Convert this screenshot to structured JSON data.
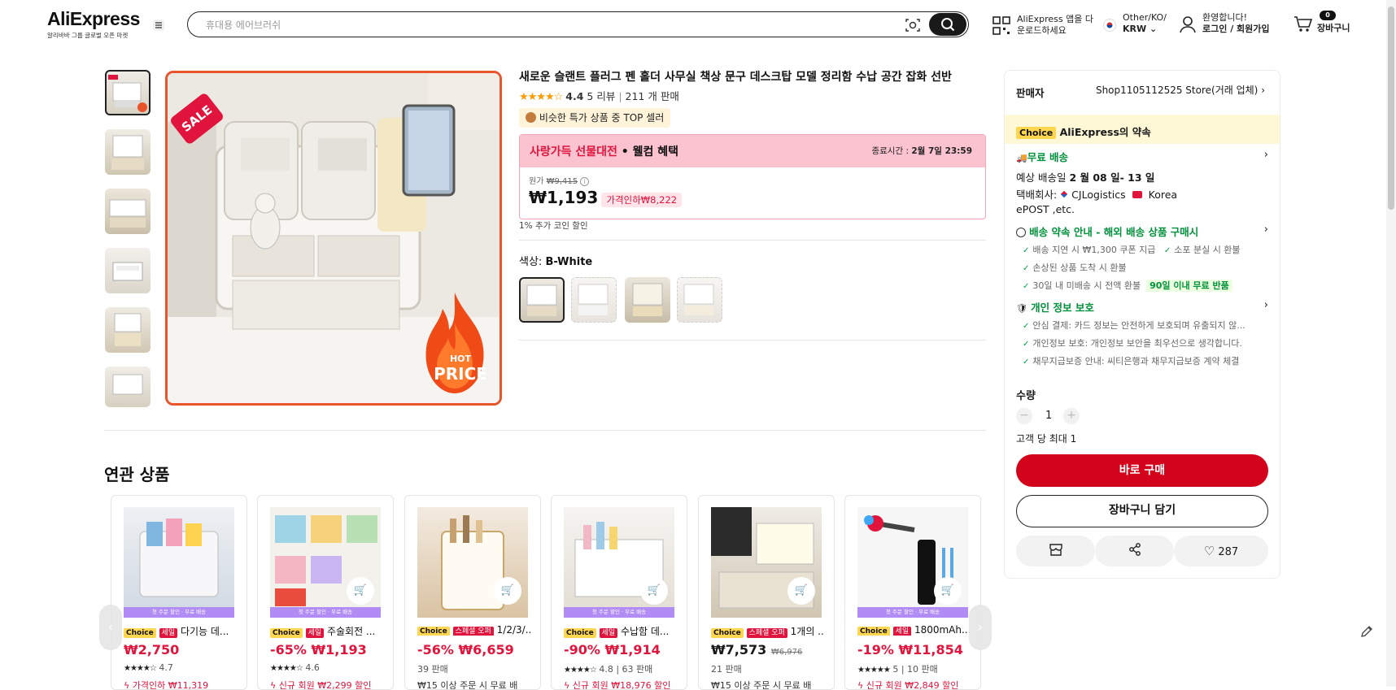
{
  "header": {
    "logo": "AliExpress",
    "logo_sub": "알리바바 그룹 글로벌 오픈 마켓",
    "search_placeholder": "휴대용 에어브러쉬",
    "app_line1": "AliExpress 앱을 다",
    "app_line2": "운로드하세요",
    "locale_line1": "Other/KO/",
    "locale_line2": "KRW",
    "user_line1": "환영합니다!",
    "user_line2": "로그인 / 회원가입",
    "cart_count": "0",
    "cart_label": "장바구니"
  },
  "product": {
    "title": "새로운 슬랜트 플러그 펜 홀더 사무실 책상 문구 데스크탑 모델 정리함 수납 공간 잡화 선반",
    "rating": "4.4",
    "reviews": "5 리뷰",
    "sold": "211 개 판매",
    "top_badge": "비슷한 특가 상품 중 TOP 셀러",
    "promo_title": "사랑가득 선물대전",
    "promo_sub": " • 웰컴 혜택",
    "promo_time_label": "종료시간 : ",
    "promo_time": "2월 7일 23:59",
    "orig_label": "원가 ",
    "orig_price": "₩9,415",
    "price": "₩1,193",
    "discount": "가격인하₩8,222",
    "coin_note": "1% 추가 코인 할인",
    "color_label": "색상: ",
    "color_value": "B-White",
    "image_labels": {
      "sale": "SALE",
      "hot": "HOT",
      "price": "PRICE"
    }
  },
  "panel": {
    "seller_label": "판매자",
    "seller_name": "Shop1105112525 Store(거래 업체)",
    "choice": "Choice",
    "promise": "AliExpress의 약속",
    "free_ship": "무료 배송",
    "eta_prefix": "예상 배송일 ",
    "eta": "2 월 08 일- 13 일",
    "carrier_prefix": "택배회사: ",
    "carrier": "CJLogistics",
    "carrier2": "Korea",
    "carrier3": "ePOST ,etc.",
    "delivery_promise": "배송 약속 안내 - 해외 배송 상품 구매시",
    "dp1": "배송 지연 시 ₩1,300 쿠폰 지급",
    "dp2": "소포 분실 시 환불",
    "dp3": "손상된 상품 도착 시 환불",
    "dp4": "30일 내 미배송 시 전액 환불",
    "dp_return": "90일 이내 무료 반품",
    "privacy": "개인 정보 보호",
    "pv1": "안심 결제: 카드 정보는 안전하게 보호되며 유출되지 않...",
    "pv2": "개인정보 보호: 개인정보 보안을 최우선으로 생각합니다.",
    "pv3": "채무지급보증 안내: 씨티은행과 채무지급보증 계약 체결",
    "qty_label": "수량",
    "qty": "1",
    "limit": "고객 당 최대 1",
    "buy_now": "바로 구매",
    "add_cart": "장바구니 담기",
    "wish_count": "287"
  },
  "related": {
    "title": "연관 상품",
    "band": "첫 주문 할인 · 무료 배송",
    "items": [
      {
        "choice": "Choice",
        "tag": "세일",
        "name": "다기능 데...",
        "price": "₩2,750",
        "meta": "4.7",
        "extra": "가격인하 ₩11,319"
      },
      {
        "choice": "Choice",
        "tag": "세일",
        "name": "주술회전 ...",
        "price": "-65% ₩1,193",
        "meta": "4.6",
        "extra": "신규 회원 ₩2,299 할인"
      },
      {
        "choice": "Choice",
        "tag": "스페셜 오퍼",
        "name": "1/2/3/...",
        "price": "-56% ₩6,659",
        "meta": "39 판매",
        "extra": "₩15 이상 주문 시 무료 배"
      },
      {
        "choice": "Choice",
        "tag": "세일",
        "name": "수납함 데...",
        "price": "-90% ₩1,914",
        "meta": "4.8 | 63 판매",
        "extra": "신규 회원 ₩18,976 할인"
      },
      {
        "choice": "Choice",
        "tag": "스페셜 오퍼",
        "name": "1개의 ...",
        "price": "₩7,573",
        "orig": "₩6,976",
        "meta": "21 판매",
        "extra": "₩15 이상 주문 시 무료 배"
      },
      {
        "choice": "Choice",
        "tag": "세일",
        "name": "1800mAh...",
        "price": "-19% ₩11,854",
        "meta": "5 | 10 판매",
        "extra": "신규 회원 ₩2,849 할인"
      }
    ]
  }
}
